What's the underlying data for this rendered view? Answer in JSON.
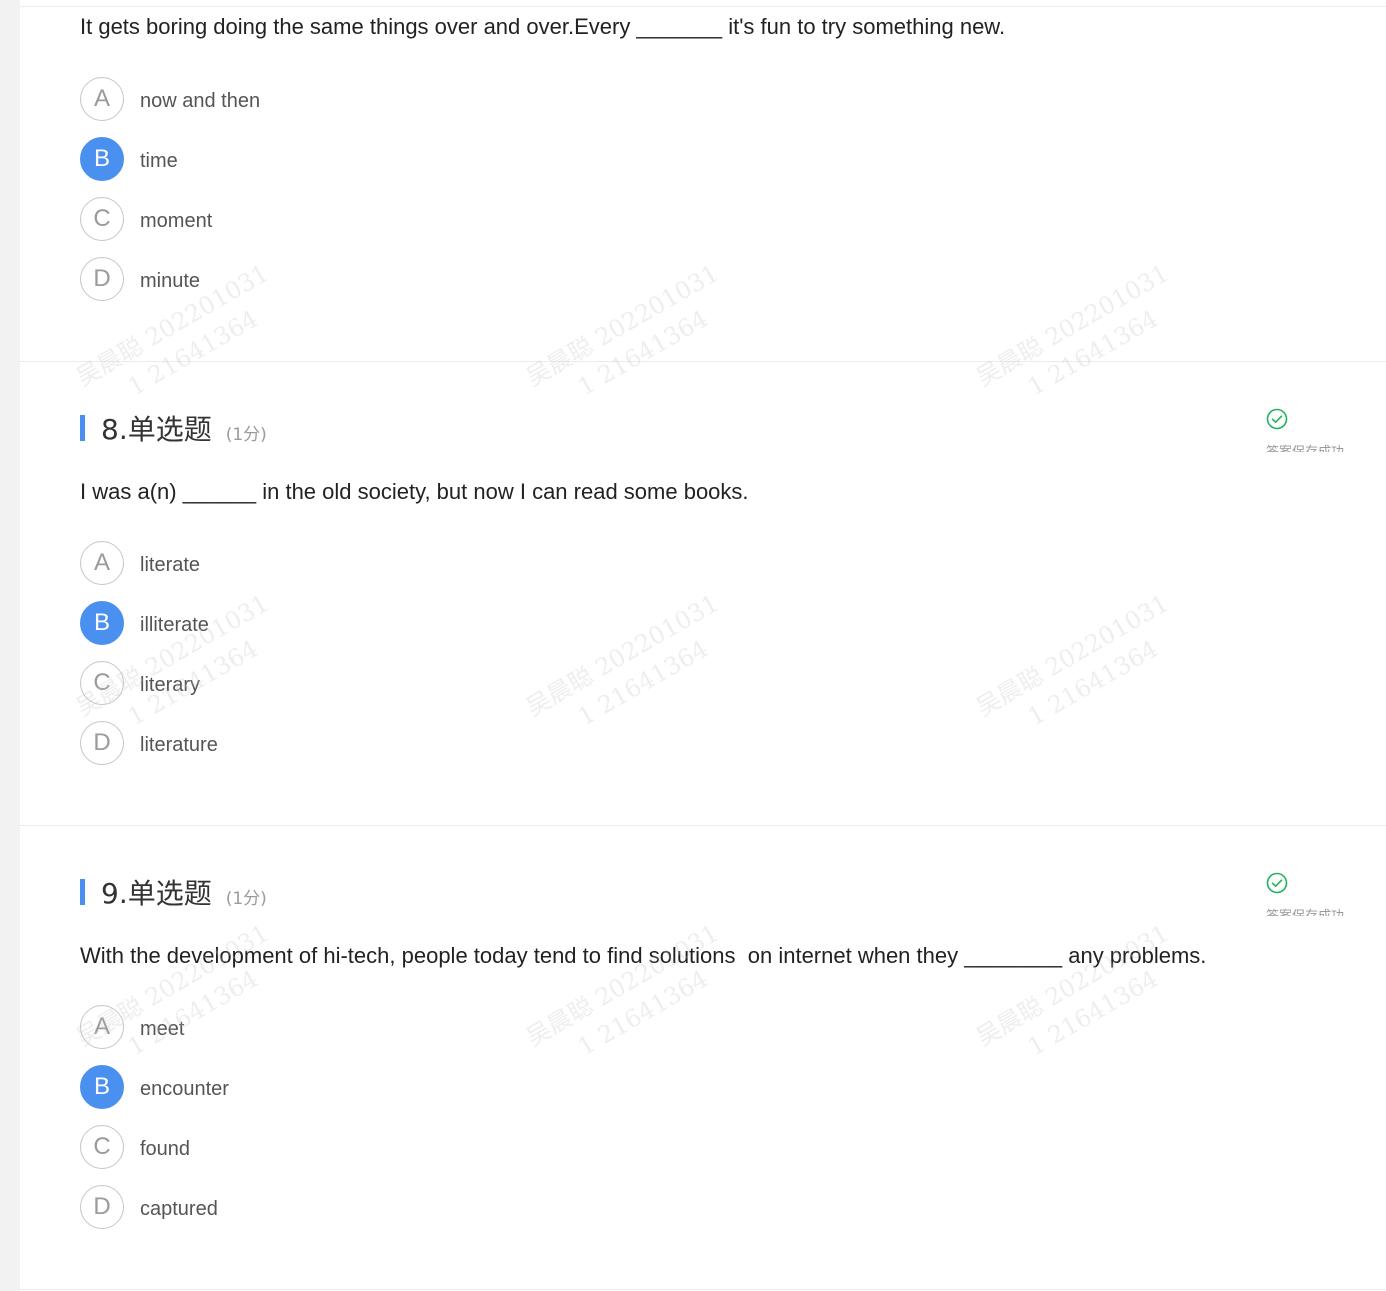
{
  "questions": [
    {
      "number_title": "",
      "score": "",
      "text": "It gets boring doing the same things over and over.Every _______ it's fun to try something new.",
      "options": [
        {
          "letter": "A",
          "label": "now and then",
          "selected": false
        },
        {
          "letter": "B",
          "label": "time",
          "selected": true
        },
        {
          "letter": "C",
          "label": "moment",
          "selected": false
        },
        {
          "letter": "D",
          "label": "minute",
          "selected": false
        }
      ]
    },
    {
      "number_title": "8.单选题",
      "score": "(1分)",
      "text": "I was a(n) ______ in the old society, but now I can read some books.",
      "save_status": "答案保存成功",
      "options": [
        {
          "letter": "A",
          "label": "literate",
          "selected": false
        },
        {
          "letter": "B",
          "label": "illiterate",
          "selected": true
        },
        {
          "letter": "C",
          "label": "literary",
          "selected": false
        },
        {
          "letter": "D",
          "label": "literature",
          "selected": false
        }
      ]
    },
    {
      "number_title": "9.单选题",
      "score": "(1分)",
      "text": "With the development of hi-tech, people today tend to find solutions  on internet when they ________ any problems.",
      "save_status": "答案保存成功",
      "options": [
        {
          "letter": "A",
          "label": "meet",
          "selected": false
        },
        {
          "letter": "B",
          "label": "encounter",
          "selected": true
        },
        {
          "letter": "C",
          "label": "found",
          "selected": false
        },
        {
          "letter": "D",
          "label": "captured",
          "selected": false
        }
      ]
    }
  ],
  "watermark": {
    "line1": "吴晨聪 202201031",
    "line2": "1 21641364"
  },
  "colors": {
    "accent": "#4a90f0",
    "success": "#1fb35a"
  },
  "icons": {
    "save_status": "check-circle-icon"
  }
}
